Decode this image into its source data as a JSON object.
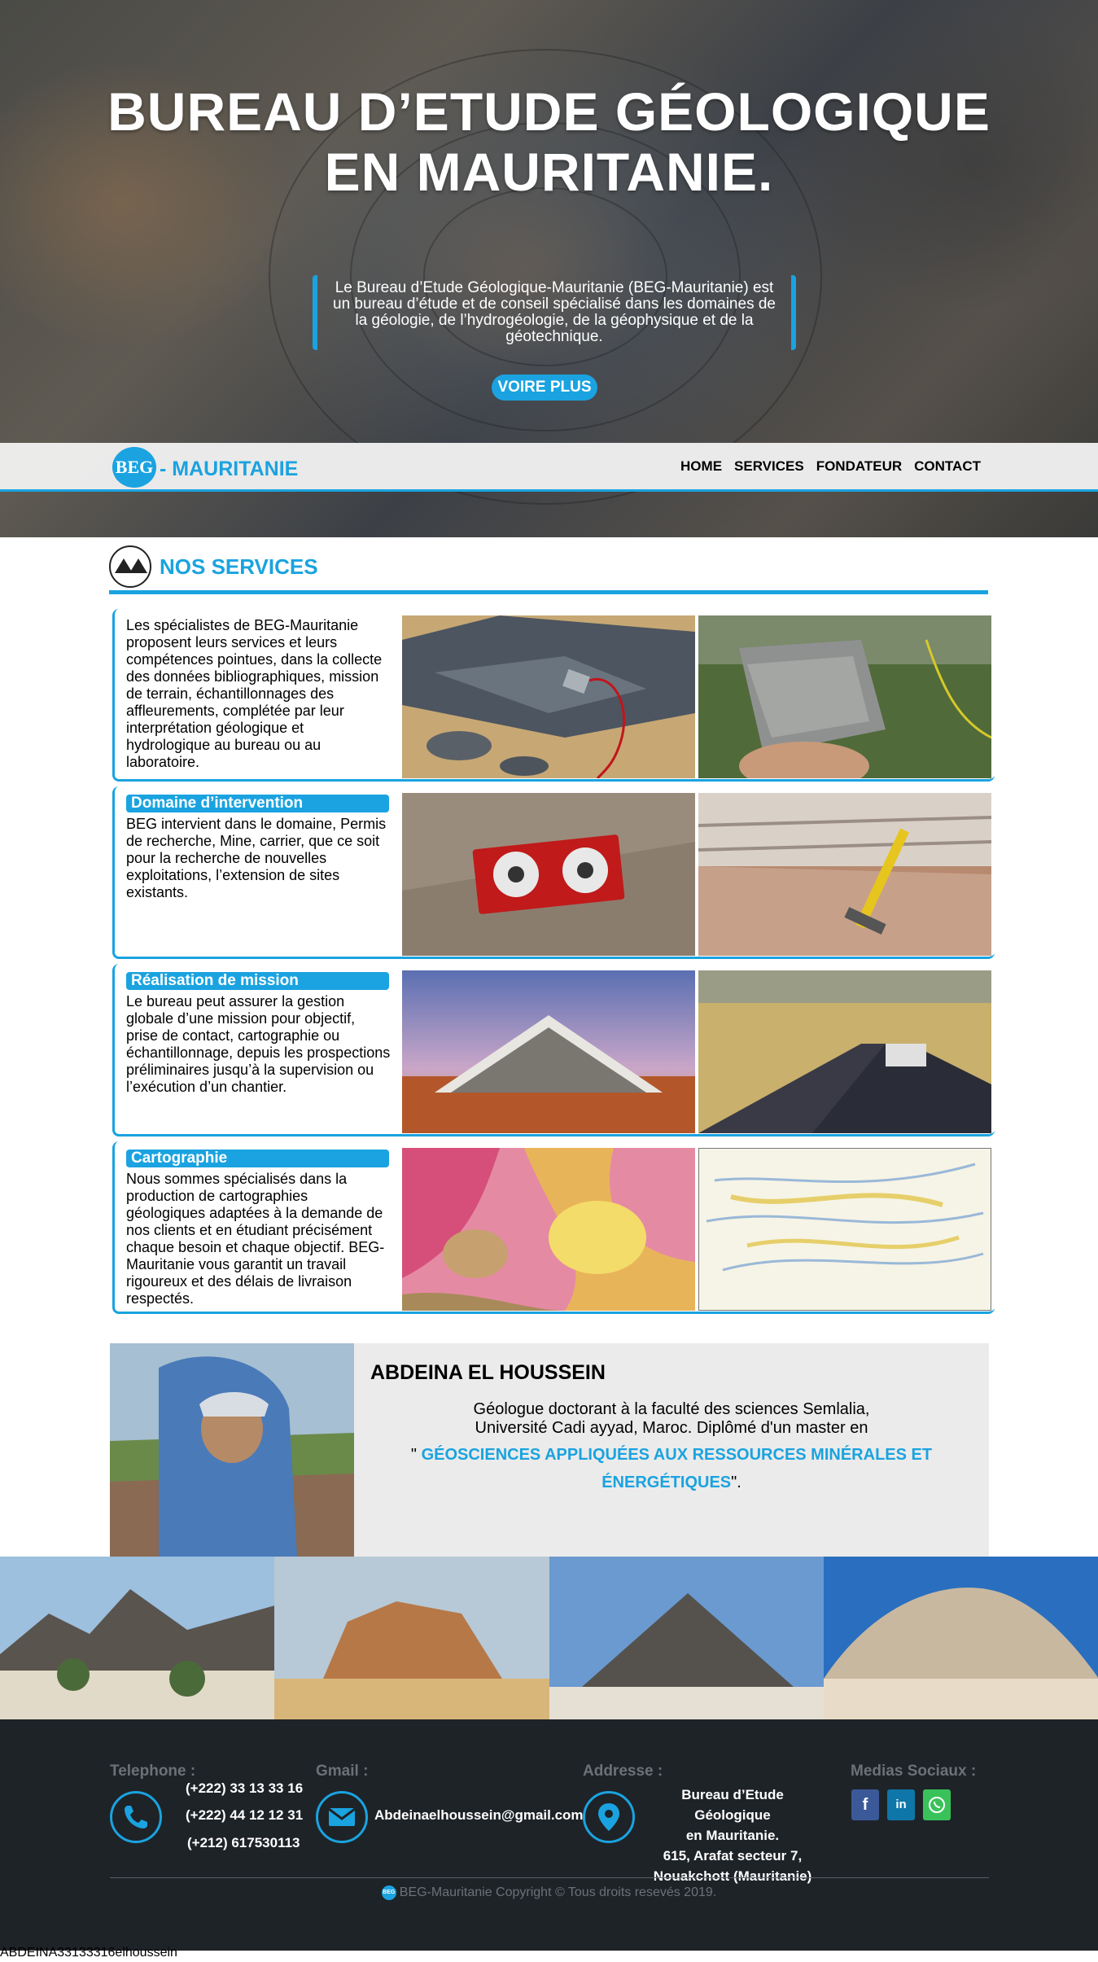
{
  "hero": {
    "title": "BUREAU D’ETUDE GÉOLOGIQUE EN MAURITANIE.",
    "intro": "Le Bureau d’Etude Géologique-Mauritanie (BEG-Mauritanie) est un bureau d’étude et de conseil spécialisé dans les domaines de la géologie, de l’hydrogéologie, de la géophysique et de la géotechnique.",
    "button": "VOIRE PLUS"
  },
  "nav": {
    "logo_mark": "BEG",
    "logo_text": "- MAURITANIE",
    "links": [
      "HOME",
      "SERVICES",
      "FONDATEUR",
      "CONTACT"
    ]
  },
  "services": {
    "title": "NOS SERVICES",
    "items": [
      {
        "label": "",
        "text": "Les spécialistes de BEG-Mauritanie proposent leurs services et leurs compétences pointues, dans la collecte des données bibliographiques, mission de terrain, échantillonnages des affleurements, complétée par leur interprétation géologique et hydrologique au bureau ou au laboratoire."
      },
      {
        "label": "Domaine d’intervention",
        "text": "BEG intervient dans le domaine, Permis de recherche, Mine, carrier, que ce soit pour la recherche de nouvelles exploitations, l’extension de sites existants."
      },
      {
        "label": "Réalisation de mission",
        "text": "Le bureau peut assurer la gestion globale d’une mission pour objectif, prise de contact, cartographie ou échantillonnage, depuis les prospections préliminaires jusqu’à la supervision ou l’exécution d’un chantier."
      },
      {
        "label": "Cartographie",
        "text": "Nous sommes spécialisés dans la production de cartographies géologiques adaptées à la demande de nos clients et en étudiant précisément chaque besoin et chaque objectif. BEG-Mauritanie vous garantit un travail rigoureux et des délais de livraison respectés."
      }
    ]
  },
  "founder": {
    "name": "ABDEINA EL HOUSSEIN",
    "bio_line1": "Géologue doctorant à la faculté des sciences Semlalia,",
    "bio_line2": "Université Cadi ayyad, Maroc. Diplômé d'un master en",
    "quote_open": "\" ",
    "highlight": "GÉOSCIENCES APPLIQUÉES AUX RESSOURCES MINÉRALES ET ÉNERGÉTIQUES",
    "quote_close": "\"."
  },
  "footer": {
    "phone_head": "Telephone :",
    "phones": [
      "(+222) 33 13 33 16",
      "(+222) 44 12 12 31",
      "(+212) 617530113"
    ],
    "gmail_head": "Gmail :",
    "email": "Abdeinaelhoussein@gmail.com",
    "address_head": "Addresse :",
    "address": [
      "Bureau d’Etude Géologique",
      "en Mauritanie.",
      "615, Arafat secteur 7,",
      "Nouakchott (Mauritanie)"
    ],
    "social_head": "Medias Sociaux :",
    "copyright_logo": "BEG",
    "copyright": "BEG-Mauritanie Copyright © Tous droits resevés 2019."
  },
  "bottom_text": "ABDEINA33133316elhoussein",
  "colors": {
    "accent": "#1aa3e0",
    "footer_bg": "#1e2328",
    "nav_bg": "#f0f0f0"
  }
}
